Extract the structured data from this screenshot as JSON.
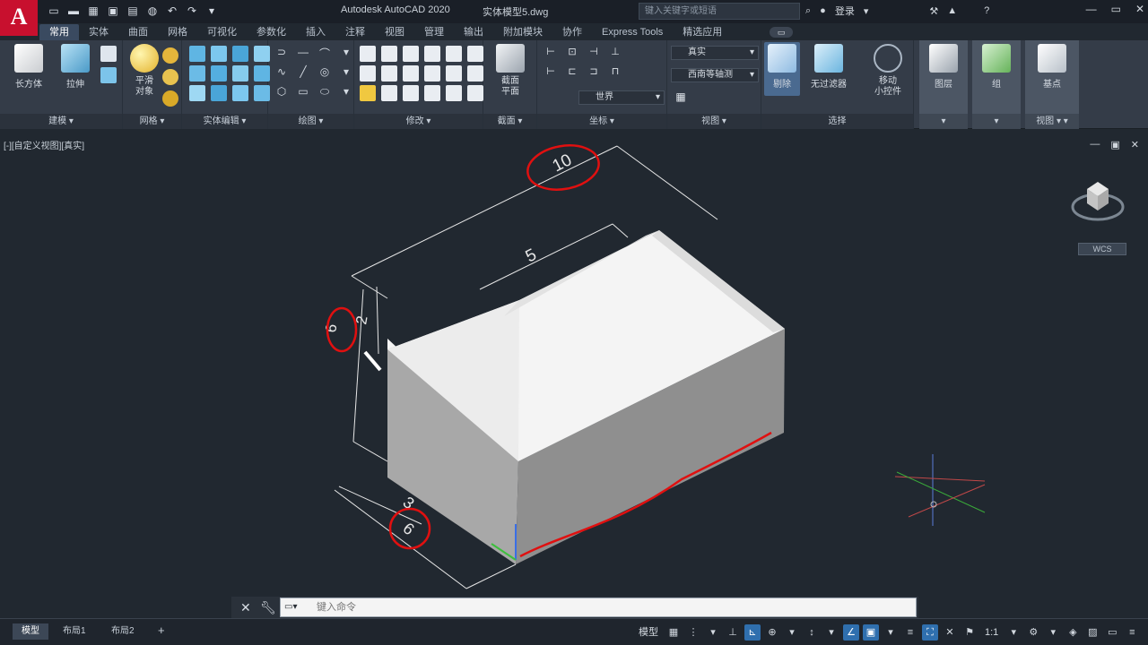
{
  "app": {
    "logo": "A",
    "title": "Autodesk AutoCAD 2020",
    "file": "实体模型5.dwg",
    "search_placeholder": "键入关键字或短语",
    "login": "登录"
  },
  "qat_icons": [
    "new-icon",
    "open-icon",
    "save-icon",
    "saveas-icon",
    "print-icon",
    "undo-icon",
    "redo-icon"
  ],
  "tabs": [
    "常用",
    "实体",
    "曲面",
    "网格",
    "可视化",
    "参数化",
    "插入",
    "注释",
    "视图",
    "管理",
    "输出",
    "附加模块",
    "协作",
    "Express Tools",
    "精选应用"
  ],
  "active_tab": "常用",
  "ribbon": {
    "panels": {
      "modeling": {
        "title": "建模",
        "box": "长方体",
        "extrude": "拉伸"
      },
      "mesh": {
        "title": "网格",
        "smooth": "平滑\n对象"
      },
      "solid_edit": {
        "title": "实体编辑"
      },
      "draw": {
        "title": "绘图"
      },
      "modify": {
        "title": "修改"
      },
      "section": {
        "title": "截面",
        "section_plane": "截面\n平面"
      },
      "coordinates": {
        "title": "坐标",
        "world": "世界"
      },
      "view": {
        "title": "视图",
        "visual_style": "真实",
        "view_preset": "西南等轴测"
      },
      "selection": {
        "title": "选择",
        "culling": "剔除",
        "no_filter": "无过滤器",
        "gizmo": "移动\n小控件"
      },
      "layers": {
        "title": "图层"
      },
      "groups": {
        "title": "组"
      },
      "view2": {
        "title": "视图",
        "base": "基点"
      }
    }
  },
  "viewport": {
    "label": "[-][自定义视图][真实]",
    "wcs": "WCS",
    "dims": {
      "d10": "10",
      "d5": "5",
      "d2": "2",
      "d6a": "6",
      "d3": "3",
      "d6b": "6"
    }
  },
  "cmdline": {
    "placeholder": "键入命令"
  },
  "statusbar": {
    "tabs": [
      "模型",
      "布局1",
      "布局2"
    ],
    "active_tab": "模型",
    "scale": "1:1"
  }
}
